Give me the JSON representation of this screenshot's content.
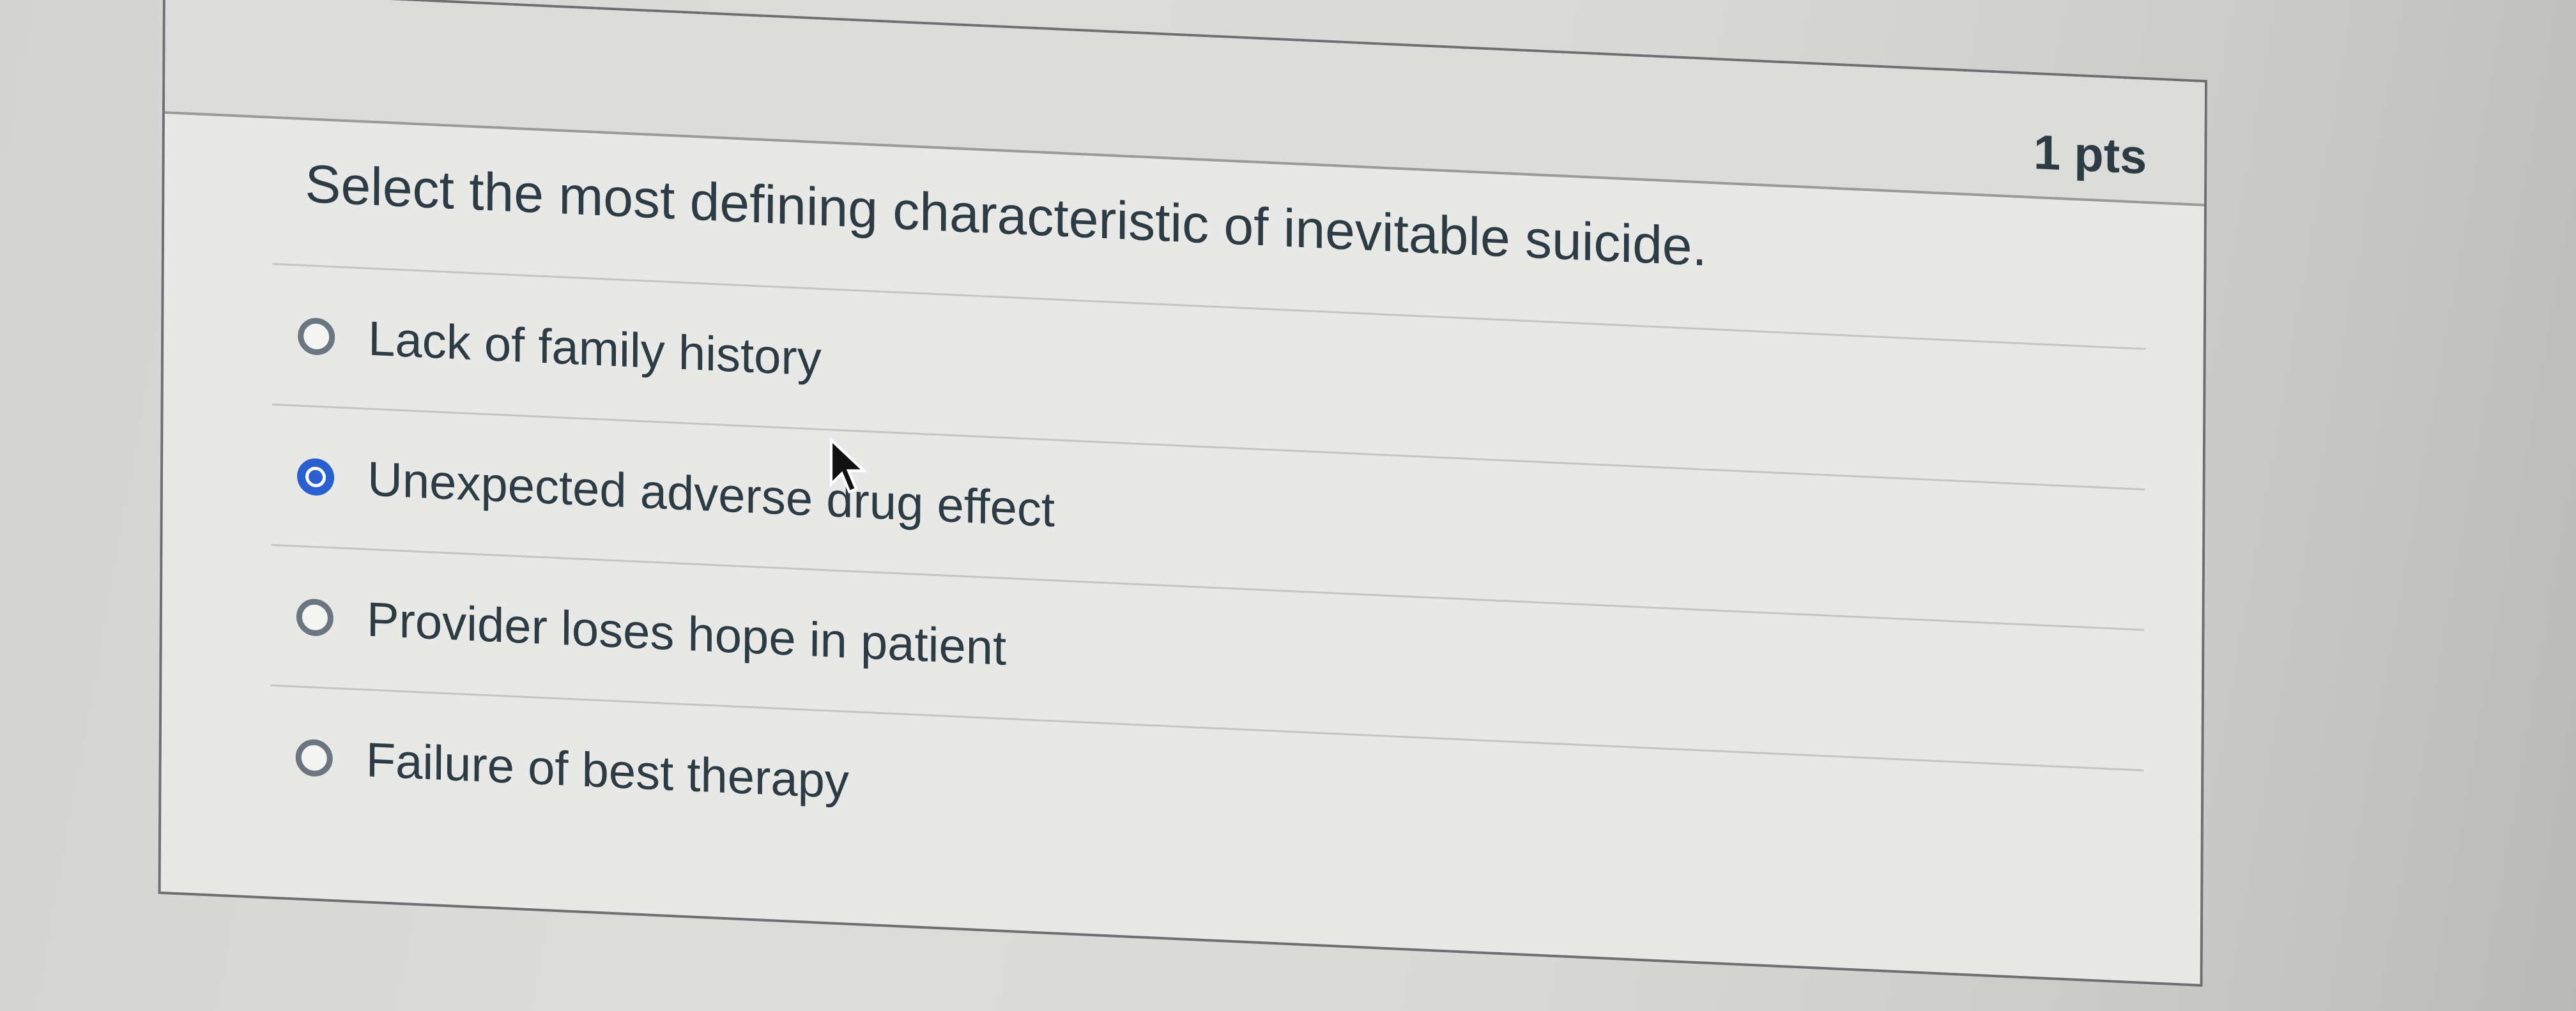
{
  "question": {
    "points": "1 pts",
    "text": "Select the most defining characteristic of inevitable suicide.",
    "answers": [
      {
        "label": "Lack of family history",
        "selected": false
      },
      {
        "label": "Unexpected adverse drug effect",
        "selected": true
      },
      {
        "label": "Provider loses hope in patient",
        "selected": false
      },
      {
        "label": "Failure of best therapy",
        "selected": false
      }
    ]
  },
  "colors": {
    "selected_radio": "#2a5fcf",
    "text": "#2d3b45"
  },
  "icons": {
    "cursor": "mouse-pointer-icon",
    "radio": "radio-button-icon"
  }
}
